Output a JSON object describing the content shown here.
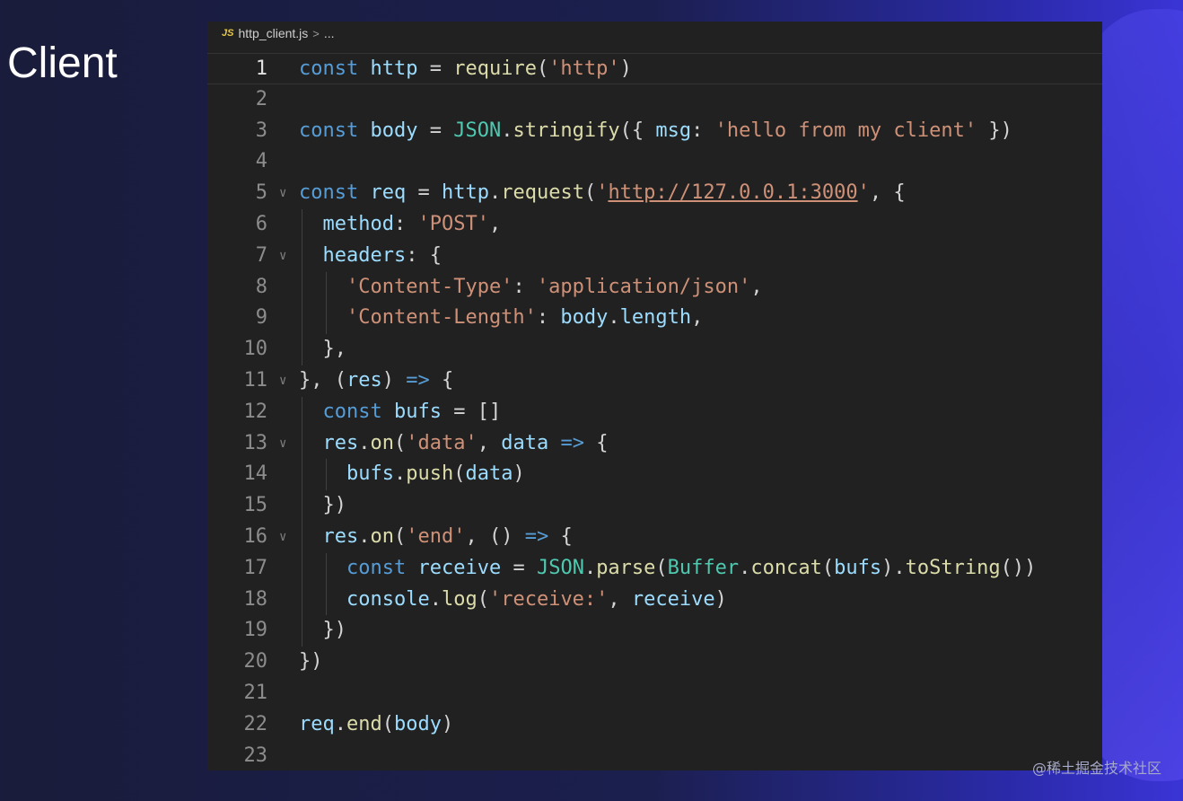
{
  "slide": {
    "title": "Client",
    "watermark": "@稀土掘金技术社区"
  },
  "editor": {
    "tab": {
      "icon": "js-file-icon",
      "icon_text": "JS",
      "filename": "http_client.js",
      "breadcrumb_sep": ">",
      "breadcrumb_more": "..."
    },
    "active_line": 1,
    "lines": [
      {
        "n": "1",
        "fold": false,
        "indent": 0,
        "tokens": [
          [
            "kw",
            "const"
          ],
          [
            "pun",
            " "
          ],
          [
            "var",
            "http"
          ],
          [
            "pun",
            " = "
          ],
          [
            "fn",
            "require"
          ],
          [
            "pun",
            "("
          ],
          [
            "str",
            "'http'"
          ],
          [
            "pun",
            ")"
          ]
        ]
      },
      {
        "n": "2",
        "fold": false,
        "indent": 0,
        "tokens": []
      },
      {
        "n": "3",
        "fold": false,
        "indent": 0,
        "tokens": [
          [
            "kw",
            "const"
          ],
          [
            "pun",
            " "
          ],
          [
            "var",
            "body"
          ],
          [
            "pun",
            " = "
          ],
          [
            "cls",
            "JSON"
          ],
          [
            "pun",
            "."
          ],
          [
            "fn",
            "stringify"
          ],
          [
            "pun",
            "({ "
          ],
          [
            "prop",
            "msg"
          ],
          [
            "pun",
            ": "
          ],
          [
            "str",
            "'hello from my client'"
          ],
          [
            "pun",
            " })"
          ]
        ]
      },
      {
        "n": "4",
        "fold": false,
        "indent": 0,
        "tokens": []
      },
      {
        "n": "5",
        "fold": true,
        "indent": 0,
        "tokens": [
          [
            "kw",
            "const"
          ],
          [
            "pun",
            " "
          ],
          [
            "var",
            "req"
          ],
          [
            "pun",
            " = "
          ],
          [
            "obj",
            "http"
          ],
          [
            "pun",
            "."
          ],
          [
            "fn",
            "request"
          ],
          [
            "pun",
            "("
          ],
          [
            "str",
            "'"
          ],
          [
            "url",
            "http://127.0.0.1:3000"
          ],
          [
            "str",
            "'"
          ],
          [
            "pun",
            ", {"
          ]
        ]
      },
      {
        "n": "6",
        "fold": false,
        "indent": 1,
        "tokens": [
          [
            "prop",
            "method"
          ],
          [
            "pun",
            ": "
          ],
          [
            "str",
            "'POST'"
          ],
          [
            "pun",
            ","
          ]
        ]
      },
      {
        "n": "7",
        "fold": true,
        "indent": 1,
        "tokens": [
          [
            "prop",
            "headers"
          ],
          [
            "pun",
            ": {"
          ]
        ]
      },
      {
        "n": "8",
        "fold": false,
        "indent": 2,
        "tokens": [
          [
            "str",
            "'Content-Type'"
          ],
          [
            "pun",
            ": "
          ],
          [
            "str",
            "'application/json'"
          ],
          [
            "pun",
            ","
          ]
        ]
      },
      {
        "n": "9",
        "fold": false,
        "indent": 2,
        "tokens": [
          [
            "str",
            "'Content-Length'"
          ],
          [
            "pun",
            ": "
          ],
          [
            "obj",
            "body"
          ],
          [
            "pun",
            "."
          ],
          [
            "prop",
            "length"
          ],
          [
            "pun",
            ","
          ]
        ]
      },
      {
        "n": "10",
        "fold": false,
        "indent": 1,
        "tokens": [
          [
            "pun",
            "},"
          ]
        ]
      },
      {
        "n": "11",
        "fold": true,
        "indent": 0,
        "tokens": [
          [
            "pun",
            "}, ("
          ],
          [
            "var",
            "res"
          ],
          [
            "pun",
            ") "
          ],
          [
            "kw",
            "=>"
          ],
          [
            "pun",
            " {"
          ]
        ]
      },
      {
        "n": "12",
        "fold": false,
        "indent": 1,
        "tokens": [
          [
            "kw",
            "const"
          ],
          [
            "pun",
            " "
          ],
          [
            "var",
            "bufs"
          ],
          [
            "pun",
            " = []"
          ]
        ]
      },
      {
        "n": "13",
        "fold": true,
        "indent": 1,
        "tokens": [
          [
            "obj",
            "res"
          ],
          [
            "pun",
            "."
          ],
          [
            "fn",
            "on"
          ],
          [
            "pun",
            "("
          ],
          [
            "str",
            "'data'"
          ],
          [
            "pun",
            ", "
          ],
          [
            "var",
            "data"
          ],
          [
            "pun",
            " "
          ],
          [
            "kw",
            "=>"
          ],
          [
            "pun",
            " {"
          ]
        ]
      },
      {
        "n": "14",
        "fold": false,
        "indent": 2,
        "tokens": [
          [
            "obj",
            "bufs"
          ],
          [
            "pun",
            "."
          ],
          [
            "fn",
            "push"
          ],
          [
            "pun",
            "("
          ],
          [
            "var",
            "data"
          ],
          [
            "pun",
            ")"
          ]
        ]
      },
      {
        "n": "15",
        "fold": false,
        "indent": 1,
        "tokens": [
          [
            "pun",
            "})"
          ]
        ]
      },
      {
        "n": "16",
        "fold": true,
        "indent": 1,
        "tokens": [
          [
            "obj",
            "res"
          ],
          [
            "pun",
            "."
          ],
          [
            "fn",
            "on"
          ],
          [
            "pun",
            "("
          ],
          [
            "str",
            "'end'"
          ],
          [
            "pun",
            ", () "
          ],
          [
            "kw",
            "=>"
          ],
          [
            "pun",
            " {"
          ]
        ]
      },
      {
        "n": "17",
        "fold": false,
        "indent": 2,
        "tokens": [
          [
            "kw",
            "const"
          ],
          [
            "pun",
            " "
          ],
          [
            "var",
            "receive"
          ],
          [
            "pun",
            " = "
          ],
          [
            "cls",
            "JSON"
          ],
          [
            "pun",
            "."
          ],
          [
            "fn",
            "parse"
          ],
          [
            "pun",
            "("
          ],
          [
            "cls",
            "Buffer"
          ],
          [
            "pun",
            "."
          ],
          [
            "fn",
            "concat"
          ],
          [
            "pun",
            "("
          ],
          [
            "var",
            "bufs"
          ],
          [
            "pun",
            ")."
          ],
          [
            "fn",
            "toString"
          ],
          [
            "pun",
            "())"
          ]
        ]
      },
      {
        "n": "18",
        "fold": false,
        "indent": 2,
        "tokens": [
          [
            "obj",
            "console"
          ],
          [
            "pun",
            "."
          ],
          [
            "fn",
            "log"
          ],
          [
            "pun",
            "("
          ],
          [
            "str",
            "'receive:'"
          ],
          [
            "pun",
            ", "
          ],
          [
            "var",
            "receive"
          ],
          [
            "pun",
            ")"
          ]
        ]
      },
      {
        "n": "19",
        "fold": false,
        "indent": 1,
        "tokens": [
          [
            "pun",
            "})"
          ]
        ]
      },
      {
        "n": "20",
        "fold": false,
        "indent": 0,
        "tokens": [
          [
            "pun",
            "})"
          ]
        ]
      },
      {
        "n": "21",
        "fold": false,
        "indent": 0,
        "tokens": []
      },
      {
        "n": "22",
        "fold": false,
        "indent": 0,
        "tokens": [
          [
            "obj",
            "req"
          ],
          [
            "pun",
            "."
          ],
          [
            "fn",
            "end"
          ],
          [
            "pun",
            "("
          ],
          [
            "var",
            "body"
          ],
          [
            "pun",
            ")"
          ]
        ]
      },
      {
        "n": "23",
        "fold": false,
        "indent": 0,
        "tokens": []
      }
    ]
  }
}
